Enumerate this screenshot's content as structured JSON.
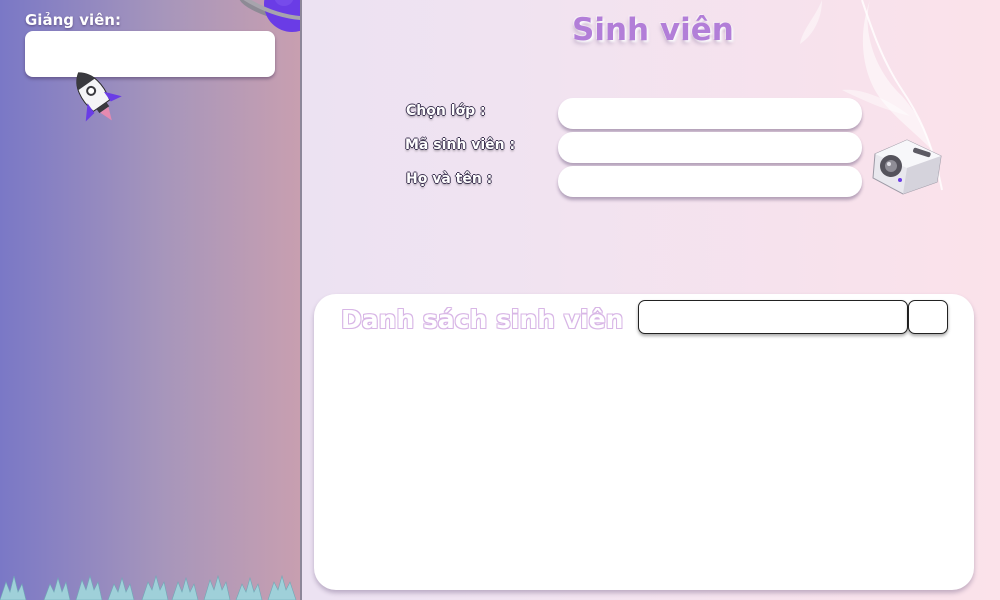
{
  "sidebar": {
    "lecturer_label": "Giảng viên:",
    "lecturer_value": ""
  },
  "main": {
    "title": "Sinh viên",
    "form": {
      "class_label": "Chọn lớp :",
      "class_value": "",
      "student_id_label": "Mã sinh viên :",
      "student_id_value": "",
      "full_name_label": "Họ và tên :",
      "full_name_value": ""
    },
    "list": {
      "title": "Danh sách sinh viên",
      "search_value": "",
      "search_button_label": "",
      "rows": []
    }
  },
  "colors": {
    "title": "#b27ed8",
    "sidebar_gradient_start": "#7a78c6",
    "sidebar_gradient_end": "#c89fb0",
    "main_background_start": "#e6e1f4",
    "main_background_end": "#fbe2ea",
    "accent_purple": "#6a3ce6"
  },
  "icons": {
    "rocket": "rocket-icon",
    "planet": "planet-icon",
    "feather": "feather-decoration-icon",
    "projector": "projector-icon",
    "grass": "grass-decoration"
  }
}
